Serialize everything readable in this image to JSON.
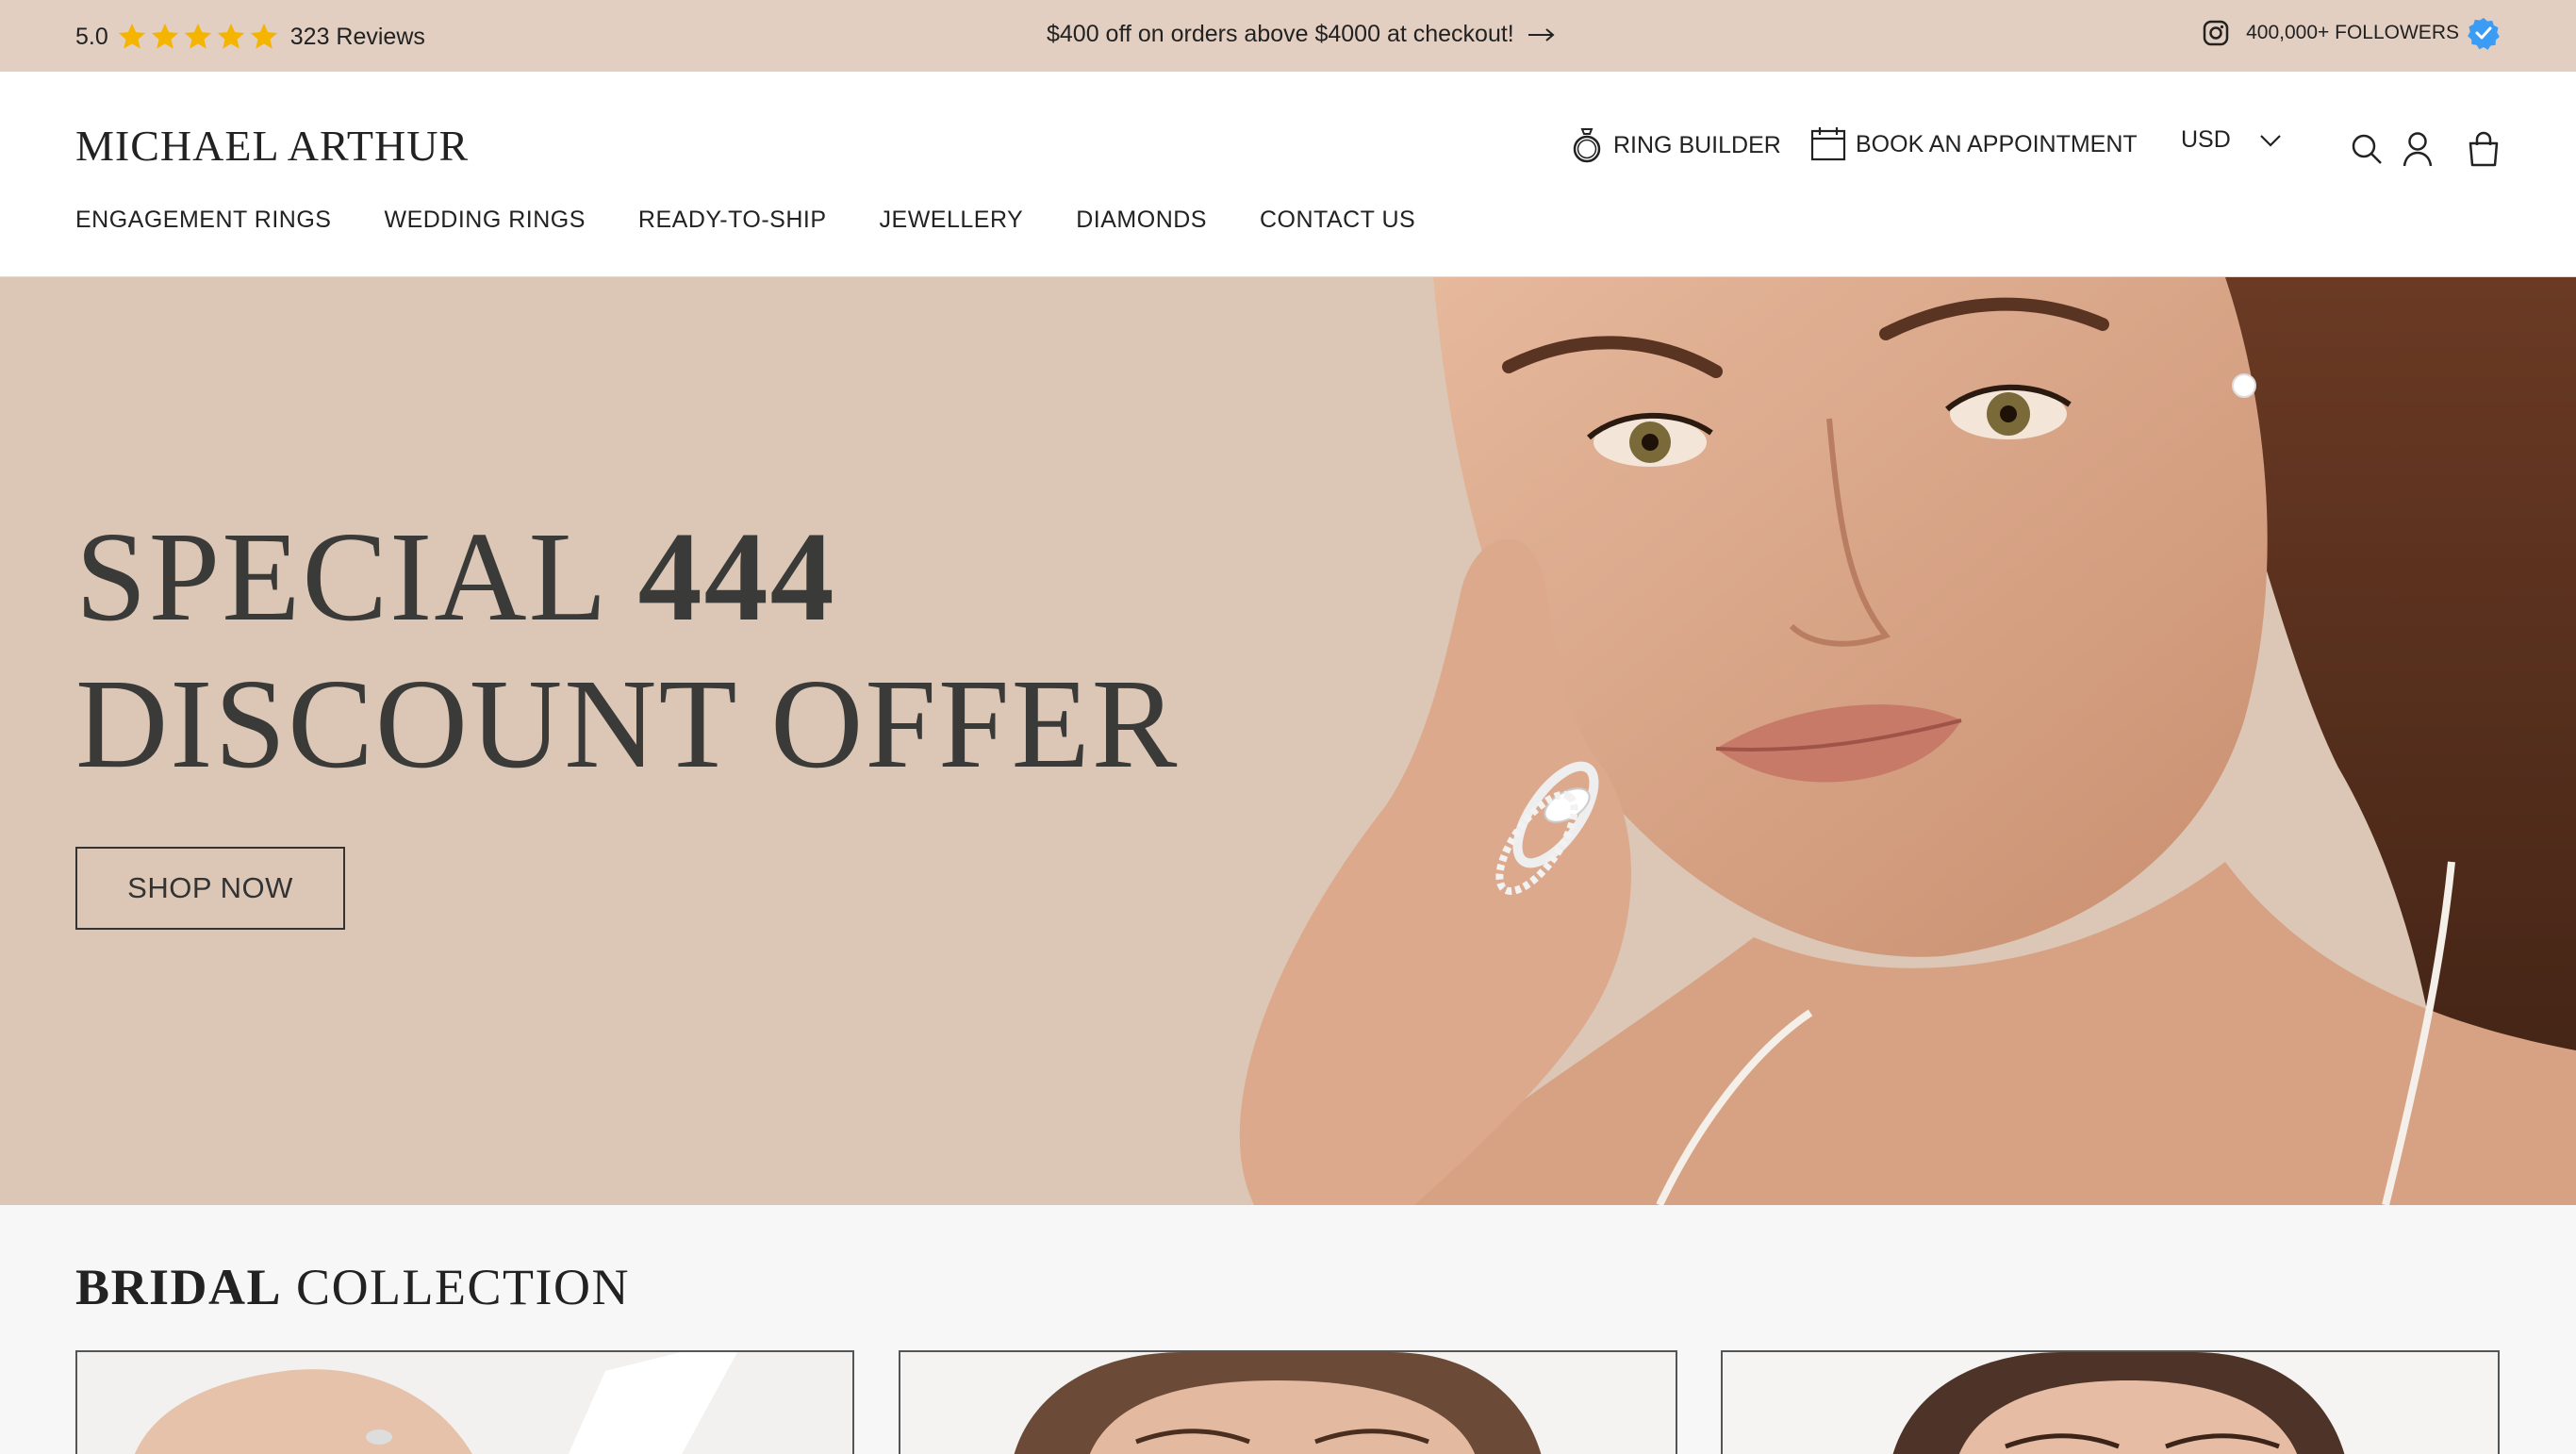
{
  "topbar": {
    "rating_score": "5.0",
    "star_count": 5,
    "reviews": "323 Reviews",
    "promo": "$400 off on orders above $4000 at checkout!",
    "followers": "400,000+ FOLLOWERS",
    "star_color": "#f4b400",
    "verified_color": "#3b9cf5",
    "background": "#e2cfc1"
  },
  "header": {
    "logo": "MICHAEL ARTHUR",
    "ring_builder": "RING BUILDER",
    "appointment": "BOOK AN APPOINTMENT",
    "currency": "USD",
    "nav": [
      "ENGAGEMENT RINGS",
      "WEDDING RINGS",
      "READY-TO-SHIP",
      "JEWELLERY",
      "DIAMONDS",
      "CONTACT US"
    ]
  },
  "hero": {
    "line1_light": "SPECIAL ",
    "line1_bold": "444",
    "line2": "DISCOUNT OFFER",
    "cta": "SHOP NOW",
    "background": "#dcc7b6"
  },
  "bridal": {
    "title_bold": "BRIDAL",
    "title_light": " COLLECTION"
  },
  "icons": [
    "star-icon",
    "arrow-right-icon",
    "instagram-icon",
    "verified-badge-icon",
    "ring-icon",
    "calendar-icon",
    "chevron-down-icon",
    "search-icon",
    "account-icon",
    "bag-icon"
  ]
}
